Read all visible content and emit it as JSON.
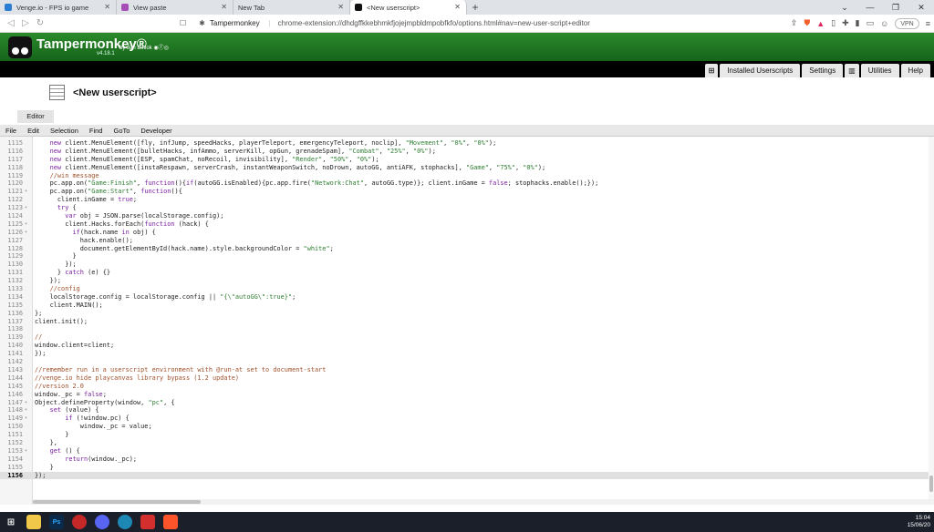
{
  "browser": {
    "tabs": [
      {
        "title": "Venge.io - FPS io game",
        "color": "#2b7cd3",
        "active": false
      },
      {
        "title": "View paste",
        "color": "#a54fb6",
        "active": false
      },
      {
        "title": "New Tab",
        "color": "#dfe3e8",
        "active": false
      },
      {
        "title": "<New userscript>",
        "color": "#111111",
        "active": true
      }
    ],
    "new_tab": "+",
    "site_name": "Tampermonkey",
    "url": "chrome-extension://dhdgffkkebhmkfjojejmpbldmpobfkfo/options.html#nav=new-user-script+editor",
    "vpn_label": "VPN"
  },
  "header": {
    "title": "Tampermonkey®",
    "byline": "by Jan Biniok",
    "version": "v4.18.1",
    "bg_color": "#1f7a1f"
  },
  "nav": {
    "add_icon": "⊞",
    "installed": "Installed Userscripts",
    "settings": "Settings",
    "utilities": "Utilities",
    "help": "Help"
  },
  "script": {
    "title": "<New userscript>",
    "editor_tab": "Editor"
  },
  "menu": [
    "File",
    "Edit",
    "Selection",
    "Find",
    "GoTo",
    "Developer"
  ],
  "code_lines": [
    {
      "n": "1115",
      "fold": "",
      "text": "    new client.MenuElement([fly, infJump, speedHacks, playerTeleport, emergencyTeleport, noclip], \"Movement\", \"0%\", \"0%\");"
    },
    {
      "n": "1116",
      "fold": "",
      "text": "    new client.MenuElement([bulletHacks, infAmmo, serverKill, opGun, grenadeSpam], \"Combat\", \"25%\", \"0%\");"
    },
    {
      "n": "1117",
      "fold": "",
      "text": "    new client.MenuElement([ESP, spamChat, noRecoil, invisibility], \"Render\", \"50%\", \"0%\");"
    },
    {
      "n": "1118",
      "fold": "",
      "text": "    new client.MenuElement([instaRespawn, serverCrash, instantWeaponSwitch, noDrown, autoGG, antiAFK, stophacks], \"Game\", \"75%\", \"0%\");"
    },
    {
      "n": "1119",
      "fold": "",
      "text": "    //win message"
    },
    {
      "n": "1120",
      "fold": "",
      "text": "    pc.app.on(\"Game:Finish\", function(){if(autoGG.isEnabled){pc.app.fire(\"Network:Chat\", autoGG.type)}; client.inGame = false; stophacks.enable();});"
    },
    {
      "n": "1121",
      "fold": "▾",
      "text": "    pc.app.on(\"Game:Start\", function(){"
    },
    {
      "n": "1122",
      "fold": "",
      "text": "      client.inGame = true;"
    },
    {
      "n": "1123",
      "fold": "▾",
      "text": "      try {"
    },
    {
      "n": "1124",
      "fold": "",
      "text": "        var obj = JSON.parse(localStorage.config);"
    },
    {
      "n": "1125",
      "fold": "▾",
      "text": "        client.Hacks.forEach(function (hack) {"
    },
    {
      "n": "1126",
      "fold": "▾",
      "text": "          if(hack.name in obj) {"
    },
    {
      "n": "1127",
      "fold": "",
      "text": "            hack.enable();"
    },
    {
      "n": "1128",
      "fold": "",
      "text": "            document.getElementById(hack.name).style.backgroundColor = \"white\";"
    },
    {
      "n": "1129",
      "fold": "",
      "text": "          }"
    },
    {
      "n": "1130",
      "fold": "",
      "text": "        });"
    },
    {
      "n": "1131",
      "fold": "",
      "text": "      } catch (e) {}"
    },
    {
      "n": "1132",
      "fold": "",
      "text": "    });"
    },
    {
      "n": "1133",
      "fold": "",
      "text": "    //config"
    },
    {
      "n": "1134",
      "fold": "",
      "text": "    localStorage.config = localStorage.config || \"{\\\"autoGG\\\":true}\";"
    },
    {
      "n": "1135",
      "fold": "",
      "text": "    client.MAIN();"
    },
    {
      "n": "1136",
      "fold": "",
      "text": "};"
    },
    {
      "n": "1137",
      "fold": "",
      "text": "client.init();"
    },
    {
      "n": "1138",
      "fold": "",
      "text": ""
    },
    {
      "n": "1139",
      "fold": "",
      "text": "//"
    },
    {
      "n": "1140",
      "fold": "",
      "text": "window.client=client;"
    },
    {
      "n": "1141",
      "fold": "",
      "text": "});"
    },
    {
      "n": "1142",
      "fold": "",
      "text": ""
    },
    {
      "n": "1143",
      "fold": "",
      "text": "//remember run in a userscript environment with @run-at set to document-start"
    },
    {
      "n": "1144",
      "fold": "",
      "text": "//venge.io hide playcanvas library bypass (1.2 update)"
    },
    {
      "n": "1145",
      "fold": "",
      "text": "//version 2.0"
    },
    {
      "n": "1146",
      "fold": "",
      "text": "window._pc = false;"
    },
    {
      "n": "1147",
      "fold": "▾",
      "text": "Object.defineProperty(window, \"pc\", {"
    },
    {
      "n": "1148",
      "fold": "▾",
      "text": "    set (value) {"
    },
    {
      "n": "1149",
      "fold": "▾",
      "text": "        if (!window.pc) {"
    },
    {
      "n": "1150",
      "fold": "",
      "text": "            window._pc = value;"
    },
    {
      "n": "1151",
      "fold": "",
      "text": "        }"
    },
    {
      "n": "1152",
      "fold": "",
      "text": "    },"
    },
    {
      "n": "1153",
      "fold": "▾",
      "text": "    get () {"
    },
    {
      "n": "1154",
      "fold": "",
      "text": "        return(window._pc);"
    },
    {
      "n": "1155",
      "fold": "",
      "text": "    }"
    },
    {
      "n": "1156",
      "fold": "",
      "text": "});"
    }
  ],
  "code_colors": {
    "comment": "#a0522d",
    "string": "#2e7d32",
    "keyword": "#7b1fa2",
    "default": "#222222"
  },
  "taskbar": {
    "time": "15:04",
    "date": "15/06/20"
  }
}
